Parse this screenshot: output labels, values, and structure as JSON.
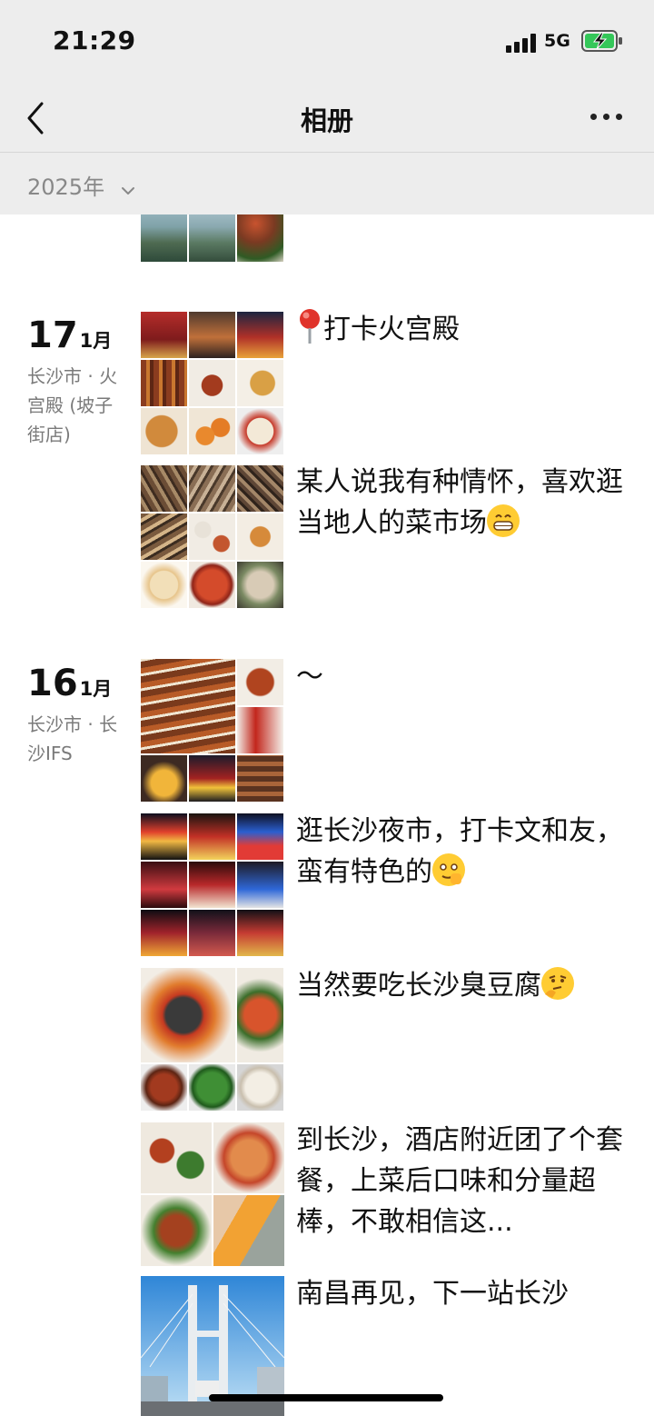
{
  "status_bar": {
    "time": "21:29",
    "network": "5G",
    "signal_bars": 4,
    "battery_charging": true
  },
  "nav": {
    "title": "相册",
    "back_icon": "chevron-left-icon",
    "more_icon": "more-dots-icon"
  },
  "year_filter": {
    "label": "2025年"
  },
  "groups": [
    {
      "day": "17",
      "month": "1月",
      "location": "长沙市 · 火宫殿 (坡子街店)",
      "posts": [
        {
          "text": "打卡火宫殿",
          "icon": "location-pin-icon"
        },
        {
          "text": "某人说我有种情怀，喜欢逛当地人的菜市场",
          "emoji": "grinning-emoji"
        }
      ]
    },
    {
      "day": "16",
      "month": "1月",
      "location": "长沙市 · 长沙IFS",
      "posts": [
        {
          "text": "～"
        },
        {
          "text": "逛长沙夜市，打卡文和友，蛮有特色的",
          "emoji": "wink-emoji"
        },
        {
          "text": "当然要吃长沙臭豆腐",
          "emoji": "thinking-emoji"
        },
        {
          "text": "到长沙，酒店附近团了个套餐，上菜后口味和分量超棒，不敢相信这..."
        },
        {
          "text": "南昌再见，下一站长沙"
        }
      ]
    }
  ],
  "colors": {
    "header_bg": "#ededed",
    "muted_text": "#888888",
    "text": "#111111"
  }
}
